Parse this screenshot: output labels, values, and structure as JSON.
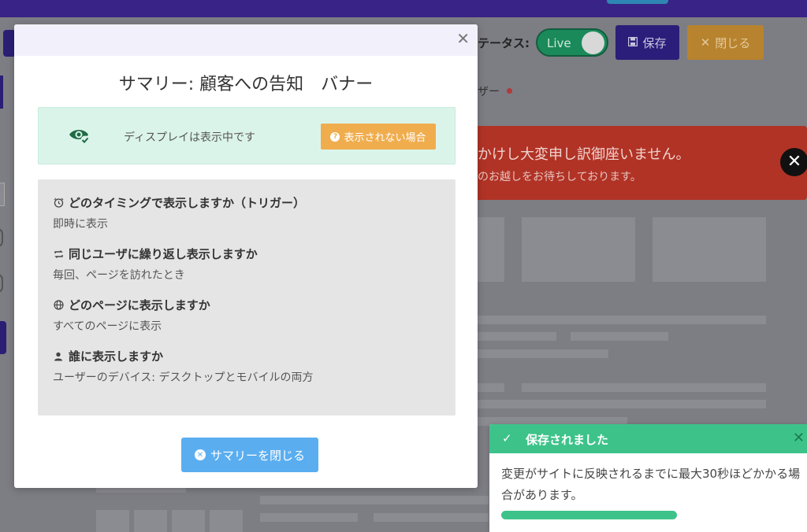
{
  "header": {
    "status_label": "テータス:",
    "live_label": "Live",
    "save_label": "保存",
    "close_label": "閉じる",
    "tab_label": "ザー"
  },
  "background_alert": {
    "line1": "かけし大変申し訳御座いません。",
    "line2": "のお越しをお待ちしております。"
  },
  "modal": {
    "title": "サマリー: 顧客への告知　バナー",
    "display_status": "ディスプレイは表示中です",
    "not_shown_button": "表示されない場合",
    "items": [
      {
        "icon": "alarm-clock-icon",
        "question": "どのタイミングで表示しますか（トリガー）",
        "answer": "即時に表示"
      },
      {
        "icon": "repeat-icon",
        "question": "同じユーザに繰り返し表示しますか",
        "answer": "毎回、ページを訪れたとき"
      },
      {
        "icon": "globe-icon",
        "question": "どのページに表示しますか",
        "answer": "すべてのページに表示"
      },
      {
        "icon": "user-icon",
        "question": "誰に表示しますか",
        "answer": "ユーザーのデバイス: デスクトップとモバイルの両方"
      }
    ],
    "close_button": "サマリーを閉じる"
  },
  "toast": {
    "title": "保存されました",
    "message": "変更がサイトに反映されるまでに最大30秒ほどかかる場合があります。",
    "progress": 0.55
  },
  "colors": {
    "accent": "#3a2387",
    "success": "#3dc38a",
    "warning": "#f0ad4e",
    "info": "#5aaef0",
    "danger": "#b13326"
  }
}
